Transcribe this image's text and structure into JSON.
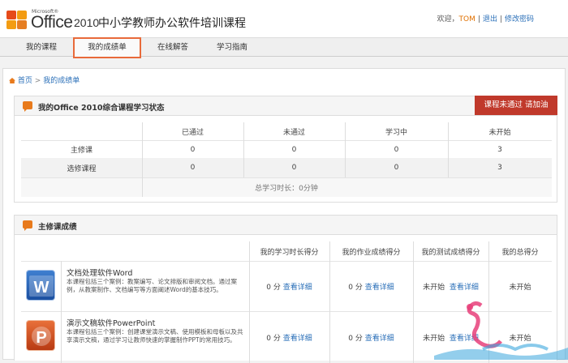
{
  "header": {
    "logo_microsoft": "Microsoft®",
    "logo_office": "Office",
    "logo_year": "2010",
    "title": "中小学教师办公软件培训课程",
    "welcome": "欢迎，",
    "user": "TOM",
    "logout": "退出",
    "change_password": "修改密码",
    "sep": "|"
  },
  "nav": {
    "items": [
      "我的课程",
      "我的成绩单",
      "在线解答",
      "学习指南"
    ],
    "active_index": 1
  },
  "breadcrumb": {
    "home": "首页",
    "sep": ">",
    "current": "我的成绩单"
  },
  "status_panel": {
    "title": "我的Office 2010综合课程学习状态",
    "button": "课程未通过 请加油",
    "columns": [
      "已通过",
      "未通过",
      "学习中",
      "未开始"
    ],
    "rows": [
      {
        "label": "主修课",
        "values": [
          "0",
          "0",
          "0",
          "3"
        ]
      },
      {
        "label": "选修课程",
        "values": [
          "0",
          "0",
          "0",
          "3"
        ]
      }
    ],
    "total": "总学习时长：0分钟"
  },
  "major_panel": {
    "title": "主修课成绩",
    "columns": [
      "我的学习时长得分",
      "我的作业成绩得分",
      "我的测试成绩得分",
      "我的总得分"
    ],
    "courses": [
      {
        "icon": "word-icon",
        "name": "文档处理软件Word",
        "desc": "本课程包括三个案例：教案编写、论文排版和审阅文档。通过案例，从教案制作、文档编写等方面阐述Word的基本技巧。",
        "study_score": "0 分",
        "study_link": "查看详细",
        "homework_score": "0 分",
        "homework_link": "查看详细",
        "test_score": "未开始",
        "test_link": "查看详细",
        "total": "未开始"
      },
      {
        "icon": "powerpoint-icon",
        "name": "演示文稿软件PowerPoint",
        "desc": "本课程包括三个案例：创建课堂演示文稿、使用模板和母板以及共享演示文稿，通过学习让教师快速的掌握制作PPT的常用技巧。",
        "study_score": "0 分",
        "study_link": "查看详细",
        "homework_score": "0 分",
        "homework_link": "查看详细",
        "test_score": "未开始",
        "test_link": "查看详细",
        "total": "未开始"
      }
    ]
  },
  "colors": {
    "accent": "#e87a1c",
    "button_red": "#c0392b",
    "link": "#2a6fb8"
  }
}
